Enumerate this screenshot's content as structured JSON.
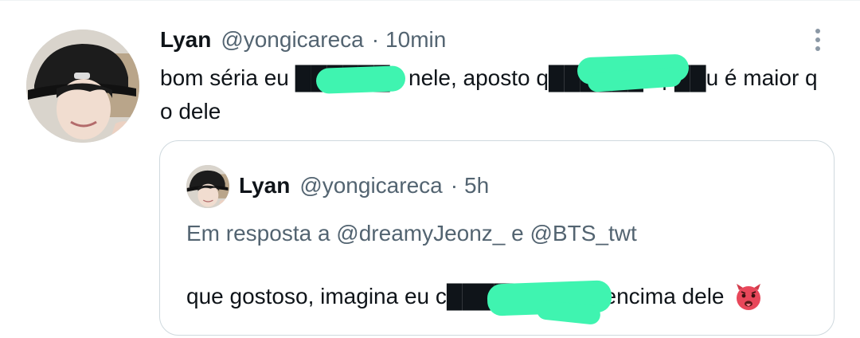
{
  "tweet": {
    "author_name": "Lyan",
    "author_handle": "@yongicareca",
    "separator": "·",
    "time": "10min",
    "text": "bom séria eu ██████o nele, aposto q██████u p██u é maior q o dele",
    "more_icon": "more-vertical-icon"
  },
  "quoted_tweet": {
    "author_name": "Lyan",
    "author_handle": "@yongicareca",
    "separator": "·",
    "time": "5h",
    "reply_to": "Em resposta a @dreamyJeonz_ e @BTS_twt",
    "text": "que gostoso, imagina eu c████████do encima dele",
    "emoji": "hot-face-devil-emoji"
  },
  "colors": {
    "redaction": "#3ff4b0",
    "secondary_text": "#536471",
    "border": "#cfd9de"
  }
}
